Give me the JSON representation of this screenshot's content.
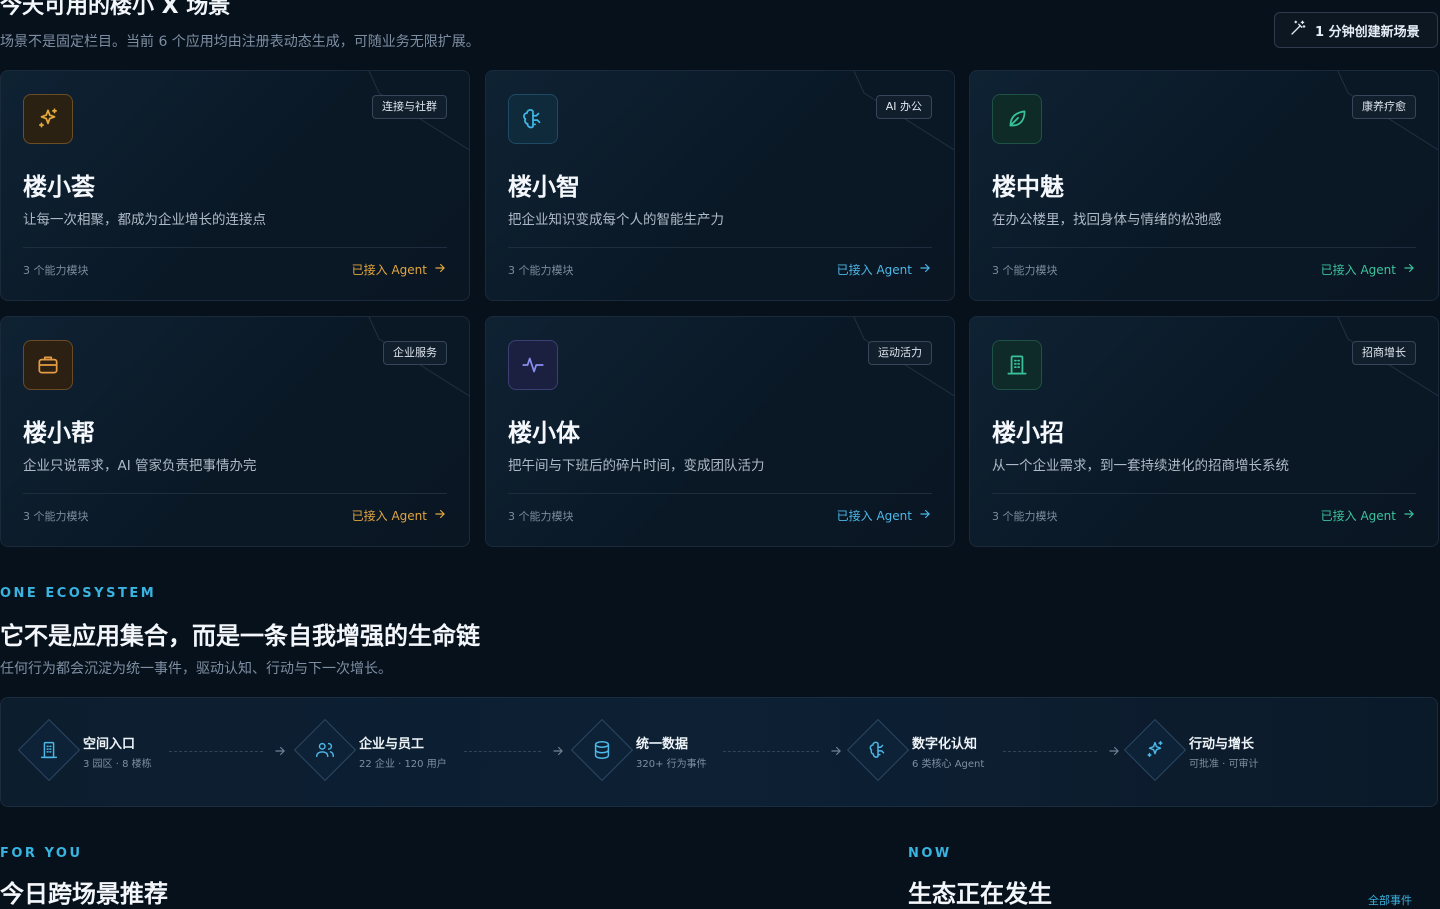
{
  "scenes": {
    "title": "今天可用的楼小 X 场景",
    "subtitle": "场景不是固定栏目。当前 6 个应用均由注册表动态生成，可随业务无限扩展。",
    "create_label": "1 分钟创建新场景",
    "cards": [
      {
        "name": "楼小荟",
        "desc": "让每一次相聚，都成为企业增长的连接点",
        "tag": "连接与社群",
        "modules": "3 个能力模块",
        "agent": "已接入 Agent",
        "icon": "sparkles-icon",
        "accent": "#e4a93c"
      },
      {
        "name": "楼小智",
        "desc": "把企业知识变成每个人的智能生产力",
        "tag": "AI 办公",
        "modules": "3 个能力模块",
        "agent": "已接入 Agent",
        "icon": "brain-icon",
        "accent": "#3fb6e6"
      },
      {
        "name": "楼中魅",
        "desc": "在办公楼里，找回身体与情绪的松弛感",
        "tag": "康养疗愈",
        "modules": "3 个能力模块",
        "agent": "已接入 Agent",
        "icon": "leaf-icon",
        "accent": "#37c29b"
      },
      {
        "name": "楼小帮",
        "desc": "企业只说需求，AI 管家负责把事情办完",
        "tag": "企业服务",
        "modules": "3 个能力模块",
        "agent": "已接入 Agent",
        "icon": "briefcase-icon",
        "accent": "#e59b45"
      },
      {
        "name": "楼小体",
        "desc": "把午间与下班后的碎片时间，变成团队活力",
        "tag": "运动活力",
        "modules": "3 个能力模块",
        "agent": "已接入 Agent",
        "icon": "activity-icon",
        "accent": "#8a8ff0"
      },
      {
        "name": "楼小招",
        "desc": "从一个企业需求，到一套持续进化的招商增长系统",
        "tag": "招商增长",
        "modules": "3 个能力模块",
        "agent": "已接入 Agent",
        "icon": "building-icon",
        "accent": "#37c29b"
      }
    ]
  },
  "ecosystem": {
    "eyebrow": "ONE ECOSYSTEM",
    "title": "它不是应用集合，而是一条自我增强的生命链",
    "subtitle": "任何行为都会沉淀为统一事件，驱动认知、行动与下一次增长。",
    "steps": [
      {
        "title": "空间入口",
        "meta": "3 园区 · 8 楼栋",
        "icon": "building-icon"
      },
      {
        "title": "企业与员工",
        "meta": "22 企业 · 120 用户",
        "icon": "users-icon"
      },
      {
        "title": "统一数据",
        "meta": "320+ 行为事件",
        "icon": "database-icon"
      },
      {
        "title": "数字化认知",
        "meta": "6 类核心 Agent",
        "icon": "brain-icon"
      },
      {
        "title": "行动与增长",
        "meta": "可批准 · 可审计",
        "icon": "sparkles-icon"
      }
    ]
  },
  "for_you": {
    "eyebrow": "FOR YOU",
    "title": "今日跨场景推荐"
  },
  "now": {
    "eyebrow": "NOW",
    "title": "生态正在发生",
    "link": "全部事件"
  }
}
